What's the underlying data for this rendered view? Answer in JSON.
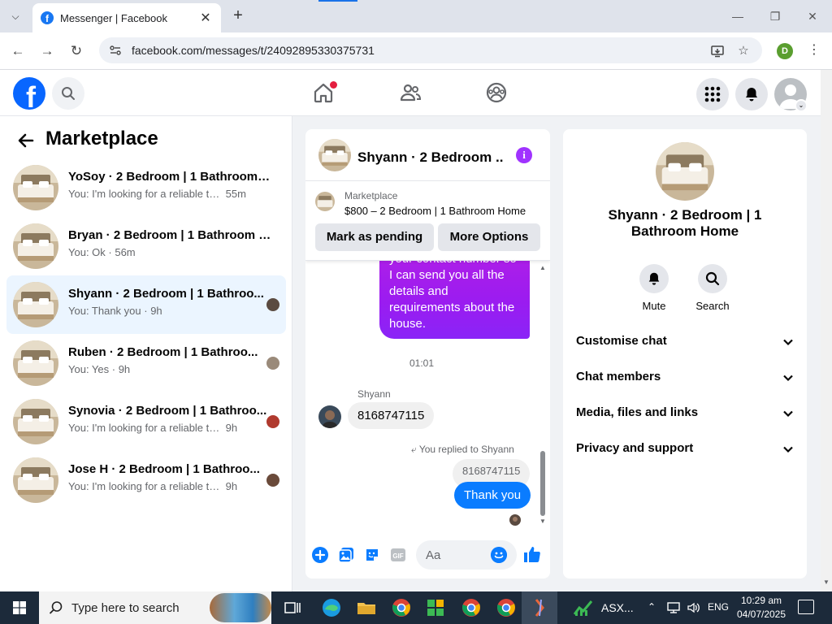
{
  "browser": {
    "tab_title": "Messenger | Facebook",
    "url": "facebook.com/messages/t/24092895330375731",
    "profile_initial": "D"
  },
  "left": {
    "title": "Marketplace",
    "conversations": [
      {
        "name": "YoSoy · 2 Bedroom | 1 Bathroom H...",
        "preview": "You: I'm looking for a reliable tenant...",
        "time": "55m",
        "sep": " "
      },
      {
        "name": "Bryan · 2 Bedroom | 1 Bathroom H...",
        "preview": "You: Ok",
        "time": "56m",
        "sep": " · "
      },
      {
        "name": "Shyann · 2 Bedroom | 1 Bathroo...",
        "preview": "You: Thank you",
        "time": "9h",
        "sep": " · "
      },
      {
        "name": "Ruben · 2 Bedroom | 1 Bathroo...",
        "preview": "You: Yes",
        "time": "9h",
        "sep": " · "
      },
      {
        "name": "Synovia · 2 Bedroom | 1 Bathroo...",
        "preview": "You: I'm looking for a reliable tenan...",
        "time": "9h",
        "sep": " "
      },
      {
        "name": "Jose H · 2 Bedroom | 1 Bathroo...",
        "preview": "You: I'm looking for a reliable tenan...",
        "time": "9h",
        "sep": " "
      }
    ]
  },
  "chat": {
    "title": "Shyann · 2 Bedroom ...",
    "marketplace_label": "Marketplace",
    "listing": "$800 – 2 Bedroom | 1 Bathroom Home",
    "mark_pending": "Mark as pending",
    "more_options": "More Options",
    "outgoing_long": "your contact number so I can send you all the details and requirements about the house.",
    "timestamp": "01:01",
    "sender": "Shyann",
    "incoming": "8168747115",
    "replied_to": "You replied to Shyann",
    "quoted": "8168747115",
    "outgoing": "Thank you",
    "placeholder": "Aa"
  },
  "right": {
    "title": "Shyann · 2 Bedroom | 1 Bathroom Home",
    "mute": "Mute",
    "search": "Search",
    "rows": [
      "Customise chat",
      "Chat members",
      "Media, files and links",
      "Privacy and support"
    ]
  },
  "taskbar": {
    "search_placeholder": "Type here to search",
    "app_label": "ASX...",
    "lang": "ENG",
    "time": "10:29 am",
    "date": "04/07/2025"
  }
}
